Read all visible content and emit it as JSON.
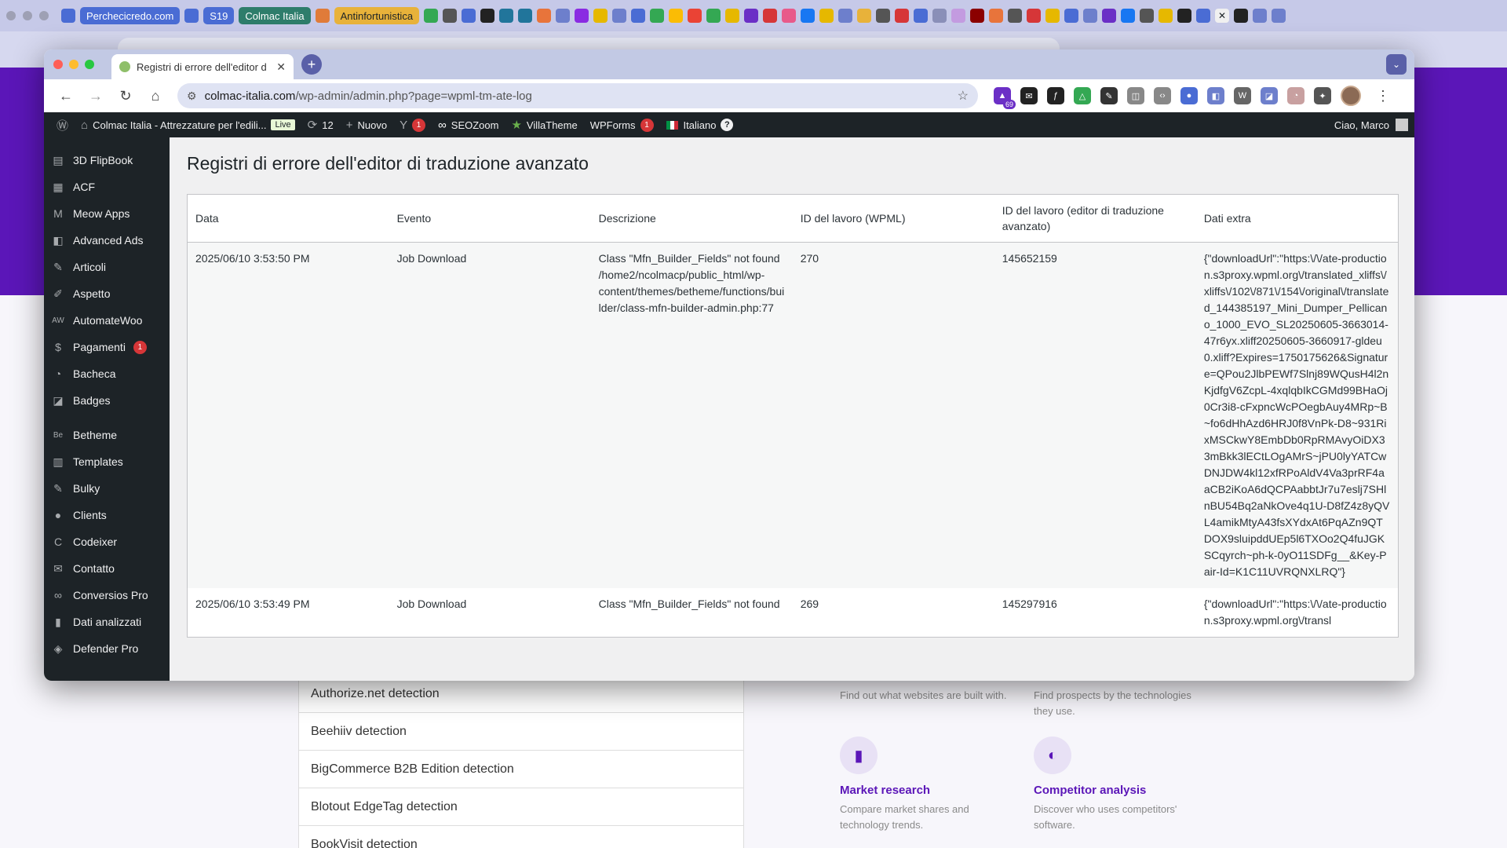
{
  "background": {
    "tabs": [
      {
        "label": "Perchecicredo.com",
        "color": "#4a6cd4"
      },
      {
        "label": "S19",
        "color": "#4a6cd4"
      },
      {
        "label": "Colmac Italia",
        "color": "#2e7d6b"
      },
      {
        "label": "Antinfortunistica",
        "color": "#e8b23a"
      }
    ],
    "list_items": [
      "Authorize.net detection",
      "Beehiiv detection",
      "BigCommerce B2B Edition detection",
      "Blotout EdgeTag detection",
      "BookVisit detection"
    ],
    "features": [
      {
        "title": "",
        "desc": "Find out what websites are built with."
      },
      {
        "title": "",
        "desc": "Find prospects by the technologies they use."
      },
      {
        "title": "Market research",
        "desc": "Compare market shares and technology trends."
      },
      {
        "title": "Competitor analysis",
        "desc": "Discover who uses competitors' software."
      }
    ]
  },
  "window": {
    "tab_title": "Registri di errore dell'editor d",
    "url_domain": "colmac-italia.com",
    "url_path": "/wp-admin/admin.php?page=wpml-tm-ate-log",
    "extension_badge": "69"
  },
  "adminbar": {
    "site_name": "Colmac Italia - Attrezzature per l'edili...",
    "live": "Live",
    "updates": "12",
    "new": "Nuovo",
    "yoast_count": "1",
    "seozoom": "SEOZoom",
    "villatheme": "VillaTheme",
    "wpforms": "WPForms",
    "wpforms_count": "1",
    "language": "Italiano",
    "greeting": "Ciao, Marco"
  },
  "sidebar": {
    "items": [
      {
        "label": "3D FlipBook",
        "icon": "book-icon",
        "glyph": "▤"
      },
      {
        "label": "ACF",
        "icon": "grid-icon",
        "glyph": "▦"
      },
      {
        "label": "Meow Apps",
        "icon": "meow-icon",
        "glyph": "M"
      },
      {
        "label": "Advanced Ads",
        "icon": "ads-icon",
        "glyph": "◧"
      },
      {
        "label": "Articoli",
        "icon": "pin-icon",
        "glyph": "✎"
      },
      {
        "label": "Aspetto",
        "icon": "brush-icon",
        "glyph": "✐"
      },
      {
        "label": "AutomateWoo",
        "icon": "automatewoo-icon",
        "glyph": "AW"
      },
      {
        "label": "Pagamenti",
        "icon": "payment-icon",
        "glyph": "$",
        "count": "1"
      },
      {
        "label": "Bacheca",
        "icon": "dashboard-icon",
        "glyph": "◔"
      },
      {
        "label": "Badges",
        "icon": "badge-icon",
        "glyph": "◪"
      },
      {
        "label": "Betheme",
        "icon": "betheme-icon",
        "glyph": "Be"
      },
      {
        "label": "Templates",
        "icon": "templates-icon",
        "glyph": "▥"
      },
      {
        "label": "Bulky",
        "icon": "bulky-icon",
        "glyph": "✎"
      },
      {
        "label": "Clients",
        "icon": "clients-icon",
        "glyph": "●"
      },
      {
        "label": "Codeixer",
        "icon": "codeixer-icon",
        "glyph": "C"
      },
      {
        "label": "Contatto",
        "icon": "mail-icon",
        "glyph": "✉"
      },
      {
        "label": "Conversios Pro",
        "icon": "infinity-icon",
        "glyph": "∞"
      },
      {
        "label": "Dati analizzati",
        "icon": "chart-icon",
        "glyph": "▮"
      },
      {
        "label": "Defender Pro",
        "icon": "shield-icon",
        "glyph": "◈"
      }
    ]
  },
  "main": {
    "title": "Registri di errore dell'editor di traduzione avanzato",
    "columns": [
      "Data",
      "Evento",
      "Descrizione",
      "ID del lavoro (WPML)",
      "ID del lavoro (editor di traduzione avanzato)",
      "Dati extra"
    ],
    "rows": [
      {
        "date": "2025/06/10 3:53:50 PM",
        "event": "Job Download",
        "description": "Class \"Mfn_Builder_Fields\" not found /home2/ncolmacp/public_html/wp-content/themes/betheme/functions/builder/class-mfn-builder-admin.php:77",
        "wpml_id": "270",
        "ate_id": "145652159",
        "extra": "{\"downloadUrl\":\"https:\\/\\/ate-production.s3proxy.wpml.org\\/translated_xliffs\\/xliffs\\/102\\/871\\/154\\/original\\/translated_144385197_Mini_Dumper_Pellicano_1000_EVO_SL20250605-3663014-47r6yx.xliff20250605-3660917-gldeu0.xliff?Expires=1750175626&Signature=QPou2JlbPEWf7Slnj89WQusH4l2nKjdfgV6ZcpL-4xqlqbIkCGMd99BHaOj0Cr3i8-cFxpncWcPOegbAuy4MRp~B~fo6dHhAzd6HRJ0f8VnPk-D8~931RixMSCkwY8EmbDb0RpRMAvyOiDX33mBkk3lECtLOgAMrS~jPU0lyYATCwDNJDW4kl12xfRPoAldV4Va3prRF4aaCB2iKoA6dQCPAabbtJr7u7eslj7SHlnBU54Bq2aNkOve4q1U-D8fZ4z8yQVL4amikMtyA43fsXYdxAt6PqAZn9QTDOX9sluipddUEp5l6TXOo2Q4fuJGKSCqyrch~ph-k-0yO11SDFg__&Key-Pair-Id=K1C11UVRQNXLRQ\"}"
      },
      {
        "date": "2025/06/10 3:53:49 PM",
        "event": "Job Download",
        "description": "Class \"Mfn_Builder_Fields\" not found",
        "wpml_id": "269",
        "ate_id": "145297916",
        "extra": "{\"downloadUrl\":\"https:\\/\\/ate-production.s3proxy.wpml.org\\/transl"
      }
    ]
  }
}
